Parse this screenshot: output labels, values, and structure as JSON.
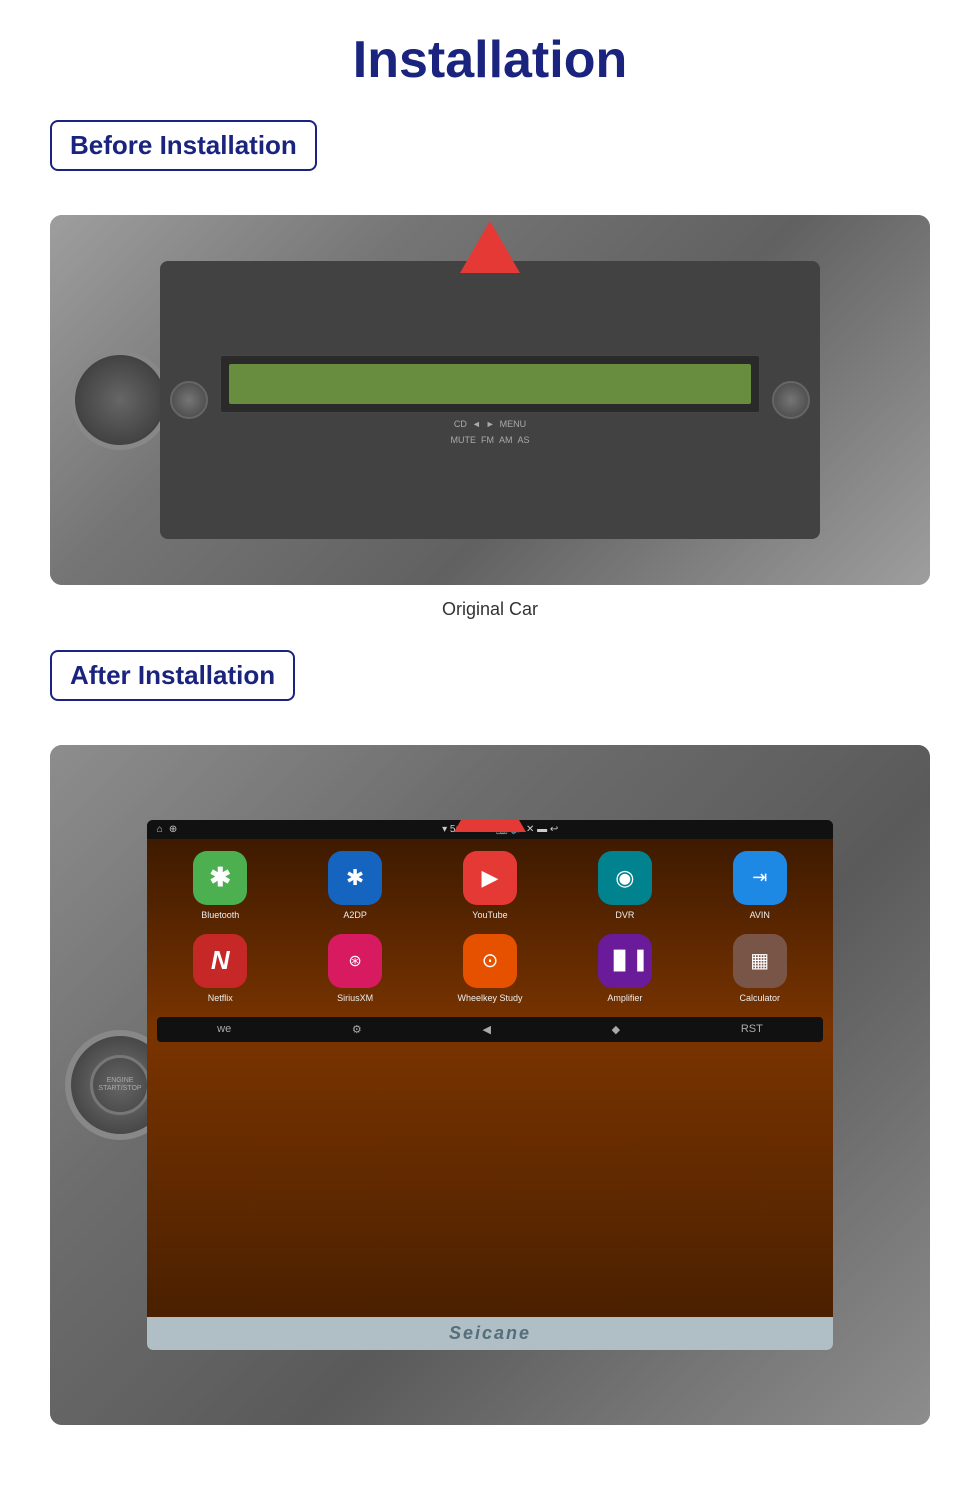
{
  "page": {
    "title": "Installation"
  },
  "before_section": {
    "label": "Before Installation",
    "image_caption": "Original Car"
  },
  "after_section": {
    "label": "After Installation"
  },
  "android_screen": {
    "statusbar": {
      "signal": "▾",
      "time": "5:28 PM",
      "icons": [
        "📷",
        "🔊",
        "✕",
        "▬",
        "↩"
      ]
    },
    "apps_row1": [
      {
        "name": "Bluetooth",
        "bg": "bg-blue-bt",
        "icon": "𝔅"
      },
      {
        "name": "A2DP",
        "bg": "bg-blue-bt",
        "icon": "✱"
      },
      {
        "name": "YouTube",
        "bg": "bg-blue-yt",
        "icon": "▶"
      },
      {
        "name": "DVR",
        "bg": "bg-teal",
        "icon": "◉"
      },
      {
        "name": "AVIN",
        "bg": "bg-blue-dvr",
        "icon": "⇥"
      }
    ],
    "apps_row2": [
      {
        "name": "Netflix",
        "bg": "bg-red",
        "icon": "N"
      },
      {
        "name": "SiriusXM",
        "bg": "bg-pink",
        "icon": "⊕"
      },
      {
        "name": "Wheelkey Study",
        "bg": "bg-orange",
        "icon": "🎯"
      },
      {
        "name": "Amplifier",
        "bg": "bg-purple",
        "icon": "▌▌▌"
      },
      {
        "name": "Calculator",
        "bg": "bg-brown",
        "icon": "▦"
      }
    ],
    "navbar_icons": [
      "🏠",
      "⚙",
      "◀",
      "◆",
      "RST"
    ],
    "brand": "Seicane"
  }
}
